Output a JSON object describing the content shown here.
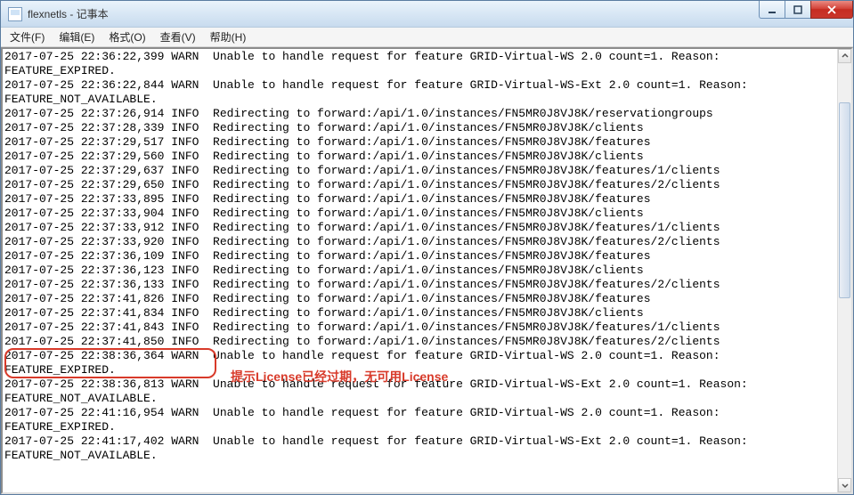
{
  "window": {
    "title": "flexnetls - 记事本"
  },
  "menu": {
    "file": "文件(F)",
    "edit": "编辑(E)",
    "format": "格式(O)",
    "view": "查看(V)",
    "help": "帮助(H)"
  },
  "log_lines": [
    "2017-07-25 22:36:22,399 WARN  Unable to handle request for feature GRID-Virtual-WS 2.0 count=1. Reason:",
    "FEATURE_EXPIRED.",
    "2017-07-25 22:36:22,844 WARN  Unable to handle request for feature GRID-Virtual-WS-Ext 2.0 count=1. Reason:",
    "FEATURE_NOT_AVAILABLE.",
    "2017-07-25 22:37:26,914 INFO  Redirecting to forward:/api/1.0/instances/FN5MR0J8VJ8K/reservationgroups",
    "2017-07-25 22:37:28,339 INFO  Redirecting to forward:/api/1.0/instances/FN5MR0J8VJ8K/clients",
    "2017-07-25 22:37:29,517 INFO  Redirecting to forward:/api/1.0/instances/FN5MR0J8VJ8K/features",
    "2017-07-25 22:37:29,560 INFO  Redirecting to forward:/api/1.0/instances/FN5MR0J8VJ8K/clients",
    "2017-07-25 22:37:29,637 INFO  Redirecting to forward:/api/1.0/instances/FN5MR0J8VJ8K/features/1/clients",
    "2017-07-25 22:37:29,650 INFO  Redirecting to forward:/api/1.0/instances/FN5MR0J8VJ8K/features/2/clients",
    "2017-07-25 22:37:33,895 INFO  Redirecting to forward:/api/1.0/instances/FN5MR0J8VJ8K/features",
    "2017-07-25 22:37:33,904 INFO  Redirecting to forward:/api/1.0/instances/FN5MR0J8VJ8K/clients",
    "2017-07-25 22:37:33,912 INFO  Redirecting to forward:/api/1.0/instances/FN5MR0J8VJ8K/features/1/clients",
    "2017-07-25 22:37:33,920 INFO  Redirecting to forward:/api/1.0/instances/FN5MR0J8VJ8K/features/2/clients",
    "2017-07-25 22:37:36,109 INFO  Redirecting to forward:/api/1.0/instances/FN5MR0J8VJ8K/features",
    "2017-07-25 22:37:36,123 INFO  Redirecting to forward:/api/1.0/instances/FN5MR0J8VJ8K/clients",
    "2017-07-25 22:37:36,133 INFO  Redirecting to forward:/api/1.0/instances/FN5MR0J8VJ8K/features/2/clients",
    "2017-07-25 22:37:41,826 INFO  Redirecting to forward:/api/1.0/instances/FN5MR0J8VJ8K/features",
    "2017-07-25 22:37:41,834 INFO  Redirecting to forward:/api/1.0/instances/FN5MR0J8VJ8K/clients",
    "2017-07-25 22:37:41,843 INFO  Redirecting to forward:/api/1.0/instances/FN5MR0J8VJ8K/features/1/clients",
    "2017-07-25 22:37:41,850 INFO  Redirecting to forward:/api/1.0/instances/FN5MR0J8VJ8K/features/2/clients",
    "2017-07-25 22:38:36,364 WARN  Unable to handle request for feature GRID-Virtual-WS 2.0 count=1. Reason:",
    "FEATURE_EXPIRED.",
    "2017-07-25 22:38:36,813 WARN  Unable to handle request for feature GRID-Virtual-WS-Ext 2.0 count=1. Reason:",
    "FEATURE_NOT_AVAILABLE.",
    "2017-07-25 22:41:16,954 WARN  Unable to handle request for feature GRID-Virtual-WS 2.0 count=1. Reason:",
    "FEATURE_EXPIRED.",
    "2017-07-25 22:41:17,402 WARN  Unable to handle request for feature GRID-Virtual-WS-Ext 2.0 count=1. Reason:",
    "FEATURE_NOT_AVAILABLE."
  ],
  "annotation": {
    "text": "提示License已经过期，无可用License"
  }
}
